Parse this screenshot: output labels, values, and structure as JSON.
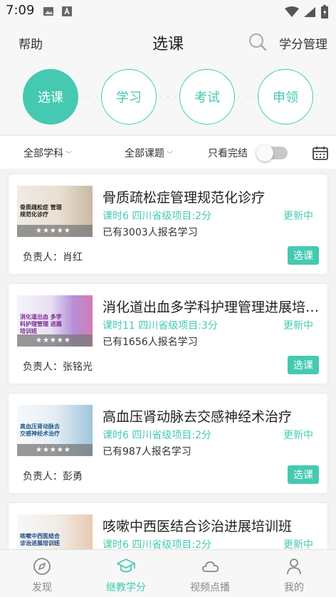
{
  "status_bar": {
    "time": "7:09"
  },
  "header": {
    "help": "帮助",
    "title": "选课",
    "credit_mgmt": "学分管理"
  },
  "steps": [
    "选课",
    "学习",
    "考试",
    "申领"
  ],
  "filters": {
    "subject": "全部学科",
    "topic": "全部课题",
    "only_finished": "只看完结"
  },
  "courses": [
    {
      "title": "骨质疏松症管理规范化诊疗",
      "meta": "课时6 四川省级项目:2分",
      "update": "更新中",
      "enrolled": "已有3003人报名学习",
      "owner": "负责人：肖红",
      "button": "选课",
      "thumb_caption": "骨质疏松症 管理规范化诊疗",
      "stars": "★★★★★"
    },
    {
      "title": "消化道出血多学科护理管理进展培训班",
      "meta": "课时11 四川省级项目:3分",
      "update": "更新中",
      "enrolled": "已有1656人报名学习",
      "owner": "负责人：张铭光",
      "button": "选课",
      "thumb_caption": "消化道出血 多学科护理管理 进展培训班",
      "stars": "★★★★★"
    },
    {
      "title": "高血压肾动脉去交感神经术治疗",
      "meta": "课时6 四川省级项目:2分",
      "update": "更新中",
      "enrolled": "已有987人报名学习",
      "owner": "负责人：彭勇",
      "button": "选课",
      "thumb_caption": "高血压肾动脉去交感神经术治疗",
      "stars": "★★★★★"
    },
    {
      "title": "咳嗽中西医结合诊治进展培训班",
      "meta": "课时6 四川省级项目:2分",
      "update": "更新中",
      "thumb_caption": "咳嗽中西医结合 诊治进展培训班"
    }
  ],
  "tabbar": [
    {
      "label": "发现",
      "icon": "compass-icon"
    },
    {
      "label": "继教学分",
      "icon": "graduation-cap-icon"
    },
    {
      "label": "视频点播",
      "icon": "cloud-icon"
    },
    {
      "label": "我的",
      "icon": "person-icon"
    }
  ],
  "colors": {
    "accent": "#45c9b1"
  }
}
